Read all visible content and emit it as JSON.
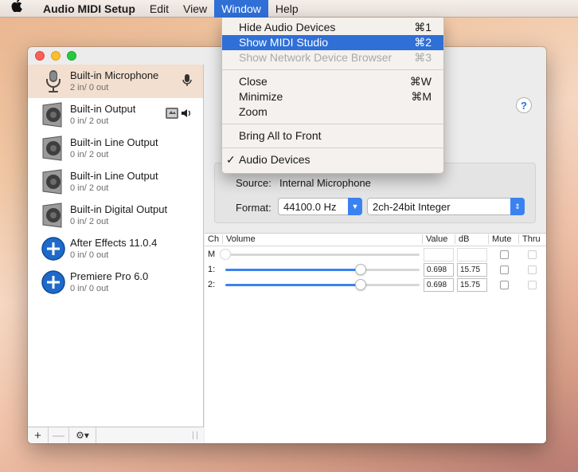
{
  "menubar": {
    "apple": "",
    "app_name": "Audio MIDI Setup",
    "items": [
      "Edit",
      "View",
      "Window",
      "Help"
    ]
  },
  "window_menu": {
    "items": [
      {
        "label": "Hide Audio Devices",
        "shortcut": "⌘1"
      },
      {
        "label": "Show MIDI Studio",
        "shortcut": "⌘2"
      },
      {
        "label": "Show Network Device Browser",
        "shortcut": "⌘3"
      },
      {
        "label": "Close",
        "shortcut": "⌘W"
      },
      {
        "label": "Minimize",
        "shortcut": "⌘M"
      },
      {
        "label": "Zoom",
        "shortcut": ""
      },
      {
        "label": "Bring All to Front",
        "shortcut": ""
      },
      {
        "label": "Audio Devices",
        "shortcut": "",
        "checkmark": "✓"
      }
    ]
  },
  "devices": [
    {
      "name": "Built-in Microphone",
      "io": "2 in/ 0 out",
      "icon": "microphone-icon"
    },
    {
      "name": "Built-in Output",
      "io": "0 in/ 2 out",
      "icon": "speaker-icon"
    },
    {
      "name": "Built-in Line Output",
      "io": "0 in/ 2 out",
      "icon": "speaker-icon"
    },
    {
      "name": "Built-in Line Output",
      "io": "0 in/ 2 out",
      "icon": "speaker-icon"
    },
    {
      "name": "Built-in Digital Output",
      "io": "0 in/ 2 out",
      "icon": "speaker-icon"
    },
    {
      "name": "After Effects 11.0.4",
      "io": "0 in/ 0 out",
      "icon": "plus-circle-icon"
    },
    {
      "name": "Premiere Pro 6.0",
      "io": "0 in/ 0 out",
      "icon": "plus-circle-icon"
    }
  ],
  "sidebar_footer": {
    "add": "+",
    "remove": "—",
    "gear": "⚙▾"
  },
  "detail": {
    "help": "?",
    "source_label": "Source:",
    "source_value": "Internal Microphone",
    "format_label": "Format:",
    "rate_value": "44100.0 Hz",
    "bits_value": "2ch-24bit Integer",
    "columns": [
      "Ch",
      "Volume",
      "Value",
      "dB",
      "Mute",
      "Thru"
    ],
    "channels": [
      {
        "label": "M",
        "volume": null,
        "value": "",
        "db": ""
      },
      {
        "label": "1:",
        "volume": 0.698,
        "value": "0.698",
        "db": "15.75"
      },
      {
        "label": "2:",
        "volume": 0.698,
        "value": "0.698",
        "db": "15.75"
      }
    ]
  },
  "colors": {
    "accent": "#3b82f0",
    "menu_highlight": "#2f6fd6",
    "selected_row": "#f3dfcf",
    "add_icon": "#1e69c9"
  }
}
